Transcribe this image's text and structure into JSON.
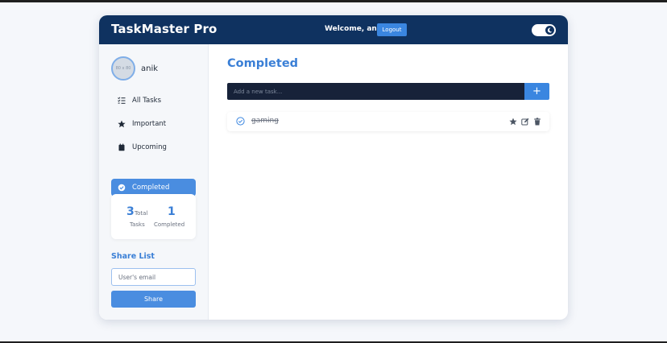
{
  "header": {
    "brand": "TaskMaster Pro",
    "welcome": "Welcome, anik",
    "logout_label": "Logout",
    "theme_toggle": "moon-icon"
  },
  "sidebar": {
    "avatar_alt": "80 x 80",
    "username": "anik",
    "nav": [
      {
        "label": "All Tasks",
        "icon": "list-icon",
        "active": false
      },
      {
        "label": "Important",
        "icon": "star-icon",
        "active": false
      },
      {
        "label": "Upcoming",
        "icon": "calendar-icon",
        "active": false
      },
      {
        "label": "Completed",
        "icon": "check-circle-icon",
        "active": true
      }
    ],
    "stats": {
      "total_value": "3",
      "total_label_1": "Total",
      "total_label_2": "Tasks",
      "completed_value": "1",
      "completed_label": "Completed"
    },
    "share": {
      "title": "Share List",
      "email_placeholder": "User's email",
      "button_label": "Share"
    }
  },
  "main": {
    "title": "Completed",
    "new_task_placeholder": "Add a new task...",
    "add_label": "+",
    "tasks": [
      {
        "text": "gaming",
        "completed": true
      }
    ]
  },
  "colors": {
    "header_bg": "#0f3260",
    "accent": "#3a7fd6",
    "active_nav": "#4a8de0",
    "input_dark": "#172239"
  }
}
